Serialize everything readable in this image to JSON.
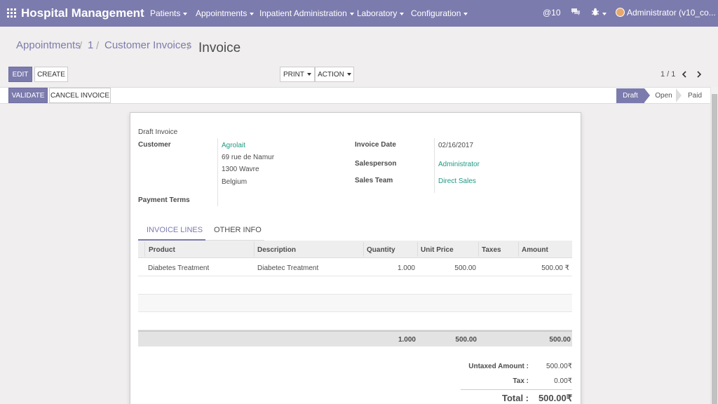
{
  "topbar": {
    "app_title": "Hospital Management",
    "menus": [
      "Patients",
      "Appointments",
      "Inpatient Administration",
      "Laboratory",
      "Configuration"
    ],
    "mentions_count": "@10",
    "user_label": "Administrator (v10_co..."
  },
  "breadcrumb": {
    "items": [
      "Appointments",
      "1",
      "Customer Invoices"
    ],
    "current": "Invoice"
  },
  "control_panel": {
    "edit_label": "EDIT",
    "create_label": "CREATE",
    "print_label": "PRINT",
    "action_label": "ACTION",
    "pager": "1 / 1"
  },
  "statusbar": {
    "validate_label": "VALIDATE",
    "cancel_label": "CANCEL INVOICE",
    "stages": [
      "Draft",
      "Open",
      "Paid"
    ],
    "active_stage": "Draft"
  },
  "invoice": {
    "state_title": "Draft Invoice",
    "customer_label": "Customer",
    "customer_name": "Agrolait",
    "address_line1": "69 rue de Namur",
    "address_line2": "1300 Wavre",
    "address_line3": "Belgium",
    "payment_terms_label": "Payment Terms",
    "invoice_date_label": "Invoice Date",
    "invoice_date": "02/16/2017",
    "salesperson_label": "Salesperson",
    "salesperson": "Administrator",
    "sales_team_label": "Sales Team",
    "sales_team": "Direct Sales"
  },
  "tabs": [
    "INVOICE LINES",
    "OTHER INFO"
  ],
  "lines": {
    "columns": [
      "Product",
      "Description",
      "Quantity",
      "Unit Price",
      "Taxes",
      "Amount"
    ],
    "rows": [
      {
        "product": "Diabetes Treatment",
        "description": "Diabetec Treatment",
        "quantity": "1.000",
        "unit_price": "500.00",
        "taxes": "",
        "amount": "500.00 ₹"
      }
    ],
    "totals": {
      "quantity": "1.000",
      "unit_price": "500.00",
      "amount": "500.00"
    }
  },
  "summary": {
    "untaxed_label": "Untaxed Amount :",
    "untaxed_value": "500.00₹",
    "tax_label": "Tax :",
    "tax_value": "0.00₹",
    "total_label": "Total :",
    "total_value": "500.00₹"
  },
  "colors": {
    "brand": "#7c7bad",
    "link": "#1d9a82"
  }
}
